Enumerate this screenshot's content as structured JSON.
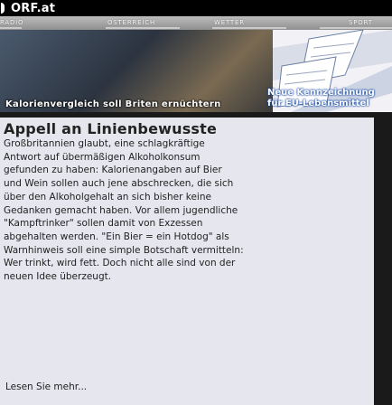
{
  "header": {
    "logo_text": "ORF.at"
  },
  "nav": {
    "items": [
      "RADIO",
      "ÖSTERREICH",
      "WETTER",
      "SPORT"
    ]
  },
  "banner": {
    "left_caption": "Kalorienvergleich soll Briten ernüchtern",
    "right_caption_1": "Neue Kennzeichnung",
    "right_caption_2": "für EU-Lebensmittel"
  },
  "article": {
    "title": "Appell an Linienbewusste",
    "lines": [
      "Großbritannien glaubt, eine schlagkräftige",
      "Antwort auf übermäßigen Alkoholkonsum",
      "gefunden zu haben: Kalorienangaben auf Bier",
      "und Wein sollen auch jene abschrecken, die sich",
      "über den Alkoholgehalt an sich bisher keine",
      "Gedanken gemacht haben. Vor allem jugendliche",
      "\"Kampftrinker\" sollen damit von Exzessen",
      "abgehalten werden. \"Ein Bier = ein Hotdog\" als",
      "Warnhinweis soll eine simple Botschaft vermitteln:",
      "Wer trinkt, wird fett. Doch nicht alle sind von der",
      "neuen Idee überzeugt."
    ],
    "more_label": "Lesen Sie mehr..."
  }
}
